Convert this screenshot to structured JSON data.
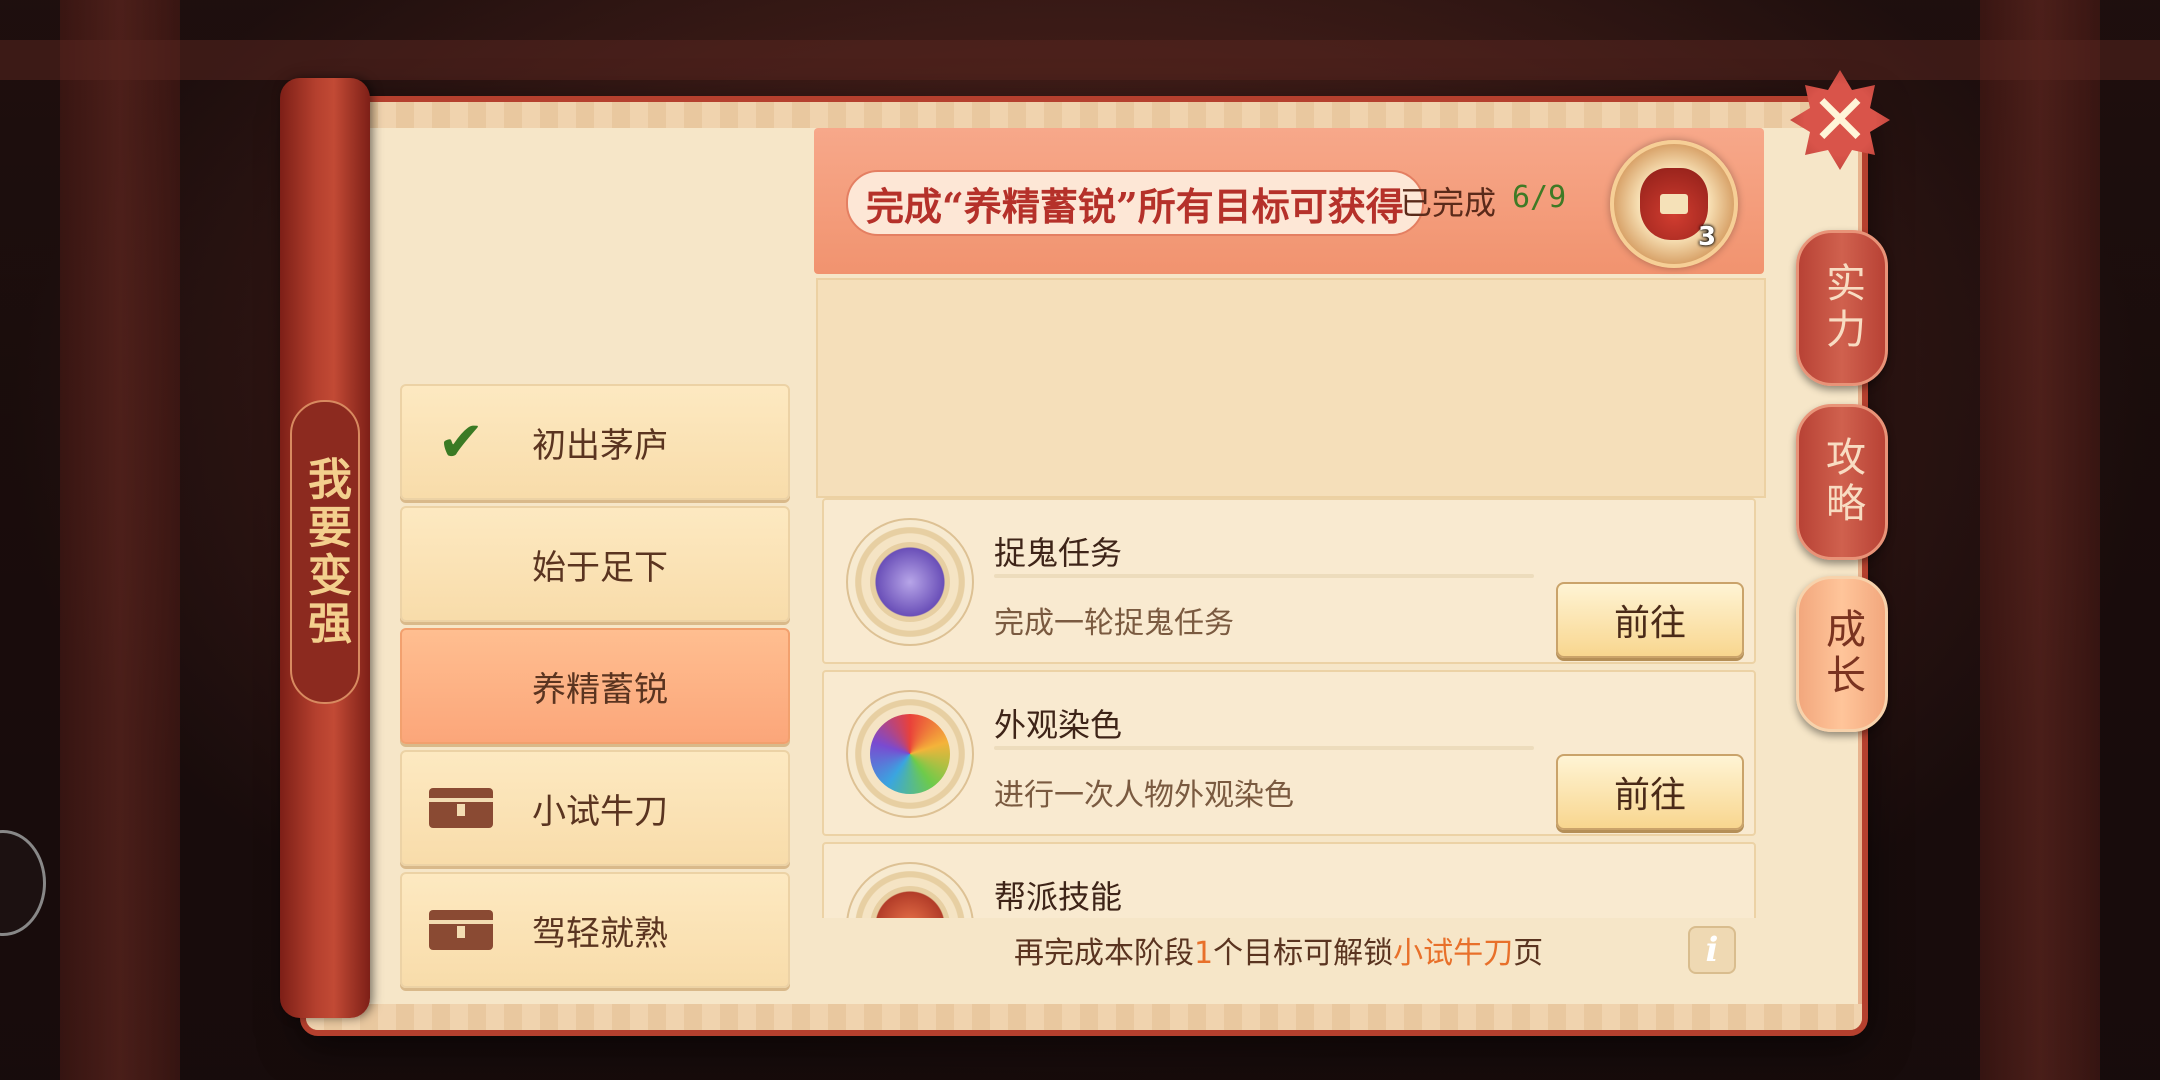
{
  "scroll_title": "我要变强",
  "stages": [
    {
      "label": "初出茅庐",
      "state": "completed",
      "icon": "check-icon"
    },
    {
      "label": "始于足下",
      "state": "unlocked",
      "icon": ""
    },
    {
      "label": "养精蓄锐",
      "state": "active",
      "icon": ""
    },
    {
      "label": "小试牛刀",
      "state": "locked",
      "icon": "lock-chest-icon"
    },
    {
      "label": "驾轻就熟",
      "state": "locked",
      "icon": "lock-chest-icon"
    }
  ],
  "banner": {
    "text": "完成“养精蓄锐”所有目标可获得",
    "done_label": "已完成",
    "done_count": "6/9",
    "reward_count": "3",
    "reward_icon": "treasure-bag-icon"
  },
  "tasks": [
    {
      "title": "捉鬼任务",
      "desc": "完成一轮捉鬼任务",
      "button": "前往",
      "icon": "scroll-icon"
    },
    {
      "title": "外观染色",
      "desc": "进行一次人物外观染色",
      "button": "前往",
      "icon": "dye-orb-icon"
    },
    {
      "title": "帮派技能",
      "desc": "",
      "button": "",
      "icon": "guild-scroll-icon"
    }
  ],
  "footer": {
    "prefix": "再完成本阶段",
    "num": "1",
    "middle": "个目标可解锁",
    "highlight": "小试牛刀",
    "suffix": "页"
  },
  "side_tabs": [
    {
      "label": "实力",
      "active": false
    },
    {
      "label": "攻略",
      "active": false
    },
    {
      "label": "成长",
      "active": true
    }
  ],
  "close_label": "✕",
  "info_label": "i",
  "colors": {
    "frame_red": "#b5402e",
    "banner": "#f1936f",
    "active_tab": "#fba67a",
    "done_green": "#3f7a25",
    "highlight_orange": "#e8702a"
  }
}
